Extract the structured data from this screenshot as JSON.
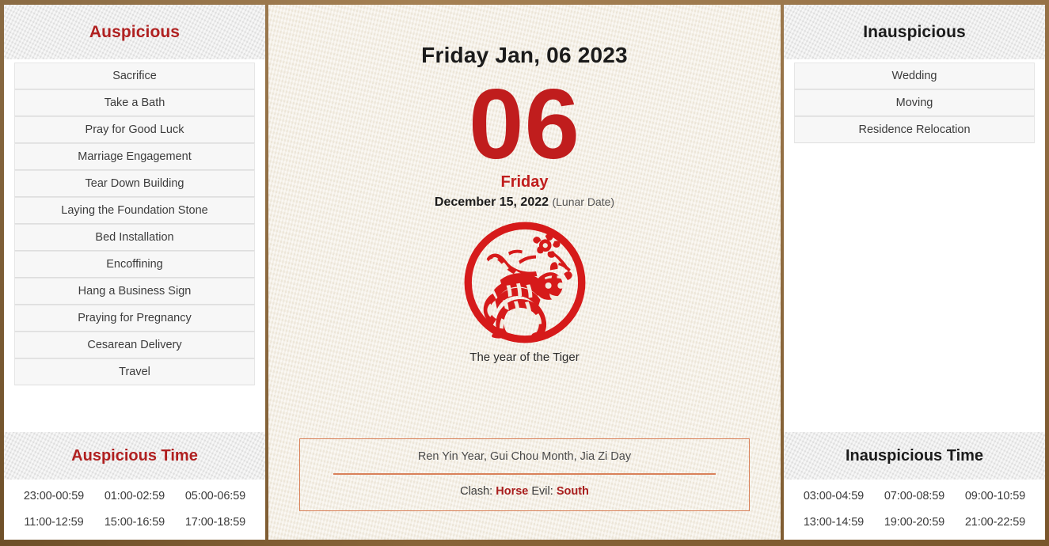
{
  "colors": {
    "frame_brown": "#8a6232",
    "accent_red": "#b02020",
    "day_red": "#c01d1d",
    "paper_cream": "#f2ece0",
    "panel_header_gray": "#e4e4e4",
    "info_border_orange": "#d9815a"
  },
  "left_panel": {
    "header": "Auspicious",
    "items": [
      "Sacrifice",
      "Take a Bath",
      "Pray for Good Luck",
      "Marriage Engagement",
      "Tear Down Building",
      "Laying the Foundation Stone",
      "Bed Installation",
      "Encoffining",
      "Hang a Business Sign",
      "Praying for Pregnancy",
      "Cesarean Delivery",
      "Travel"
    ],
    "time_header": "Auspicious Time",
    "times": [
      "23:00-00:59",
      "01:00-02:59",
      "05:00-06:59",
      "11:00-12:59",
      "15:00-16:59",
      "17:00-18:59"
    ]
  },
  "center_panel": {
    "title": "Friday Jan, 06 2023",
    "day_number": "06",
    "weekday": "Friday",
    "lunar_date": "December 15, 2022",
    "lunar_note": "(Lunar Date)",
    "zodiac_icon": "tiger-papercut-icon",
    "zodiac_caption": "The year of the Tiger",
    "info": {
      "pillars": "Ren Yin Year, Gui Chou Month, Jia Zi Day",
      "clash_label": "Clash:",
      "clash_value": "Horse",
      "evil_label": "Evil:",
      "evil_value": "South"
    }
  },
  "right_panel": {
    "header": "Inauspicious",
    "items": [
      "Wedding",
      "Moving",
      "Residence Relocation"
    ],
    "time_header": "Inauspicious Time",
    "times": [
      "03:00-04:59",
      "07:00-08:59",
      "09:00-10:59",
      "13:00-14:59",
      "19:00-20:59",
      "21:00-22:59"
    ]
  }
}
